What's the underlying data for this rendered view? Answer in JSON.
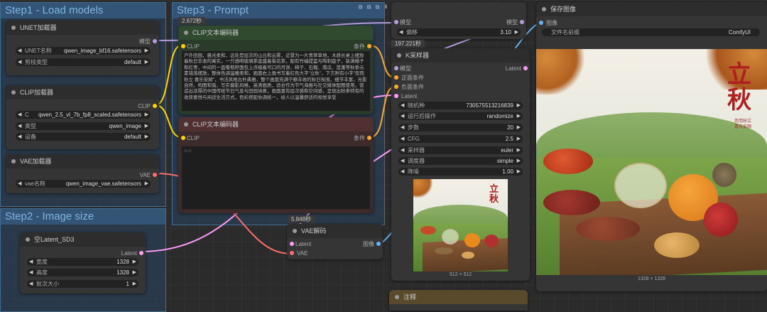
{
  "groups": {
    "step1": "Step1 - Load models",
    "step2": "Step2 - Image size",
    "step3": "Step3 - Prompt"
  },
  "unet_loader": {
    "title": "UNET加载器",
    "output": "模型",
    "widgets": [
      {
        "label": "UNET名称",
        "value": "qwen_image_bf16.safetensors"
      },
      {
        "label": "剪枝类型",
        "value": "default"
      }
    ]
  },
  "clip_loader": {
    "title": "CLIP加载器",
    "output": "CLIP",
    "widgets": [
      {
        "label": "C",
        "value": "qwen_2.5_vl_7b_fp8_scaled.safetensors"
      },
      {
        "label": "类型",
        "value": "qwen_image"
      },
      {
        "label": "设备",
        "value": "default"
      }
    ]
  },
  "vae_loader": {
    "title": "VAE加载器",
    "output": "VAE",
    "widgets": [
      {
        "label": "vae名称",
        "value": "qwen_image_vae.safetensors"
      }
    ]
  },
  "empty_latent": {
    "title": "空Latent_SD3",
    "output": "Latent",
    "widgets": [
      {
        "label": "宽度",
        "value": "1328"
      },
      {
        "label": "高度",
        "value": "1328"
      },
      {
        "label": "批次大小",
        "value": "1"
      }
    ]
  },
  "clip_pos": {
    "badge": "2.672秒",
    "title": "CLIP文本编码器",
    "input": "CLIP",
    "output": "条件",
    "text": "户外田园，晨光柔和，远处是层次的山丘和云雾，近景为一片青翠草地，木质长桌上摆放着秋日丰收的果实，一只透明玻璃茶壶盛着菊花茶，配有竹编提篮与陶制盘子，装满橘子和红枣，中间的一盘葡萄籽面包上点缀着可口的月饼，柿子、石榴、南瓜、莲蓬等秋季元素错落摆放，整体色调温暖柔和，画面右上角书写着红色大字\"立秋\"，下方附有小字\"忽而秋立 喜乐安顺\"，书法风格古朴典雅，整个画面充满宁静丰收的秋日氛围，细节丰富，光影自然，构图和谐，写实摄影风格，高清画质，适合作为节气海报与社交媒体配图使用，营造出浓厚的中国传统节日气息与田园诗意，画面富有层次感和空间感，呈现出秋季特有的收获喜悦与闲适生活方式，色彩搭配协调统一，给人以温馨舒适的视觉享受"
  },
  "clip_neg": {
    "title": "CLIP文本编码器",
    "input": "CLIP",
    "output": "条件",
    "placeholder": "text"
  },
  "model_sampling": {
    "input": "模型",
    "output": "模型",
    "widgets": [
      {
        "label": "偏移",
        "value": "3.10"
      }
    ]
  },
  "ksampler": {
    "badge": "197.221秒",
    "title": "K采样器",
    "inputs": [
      "模型",
      "正面条件",
      "负面条件",
      "Latent"
    ],
    "output": "Latent",
    "widgets": [
      {
        "label": "随机种",
        "value": "730575513216839"
      },
      {
        "label": "运行后操作",
        "value": "randomize"
      },
      {
        "label": "步数",
        "value": "20"
      },
      {
        "label": "CFG",
        "value": "2.5"
      },
      {
        "label": "采样器",
        "value": "euler"
      },
      {
        "label": "调度器",
        "value": "simple"
      },
      {
        "label": "降噪",
        "value": "1.00"
      }
    ],
    "preview_size": "512 × 512"
  },
  "vae_decode": {
    "badge": "5.848秒",
    "title": "VAE解码",
    "inputs": [
      "Latent",
      "VAE"
    ],
    "output": "图像"
  },
  "save_image": {
    "title": "保存图像",
    "input": "图像",
    "widgets": [
      {
        "label": "文件名前缀",
        "value": "ComfyUI"
      }
    ],
    "image_size": "1328 × 1328"
  },
  "note": {
    "title": "注释"
  },
  "poster": {
    "title": "立秋",
    "line1": "忽而秋立",
    "line2": "喜乐安顺"
  },
  "colors": {
    "model": "#b39ddb",
    "clip": "#ffd500",
    "vae": "#ff6e6e",
    "latent": "#ff9cf9",
    "conditioning": "#ffa931",
    "image": "#64b5f6"
  }
}
